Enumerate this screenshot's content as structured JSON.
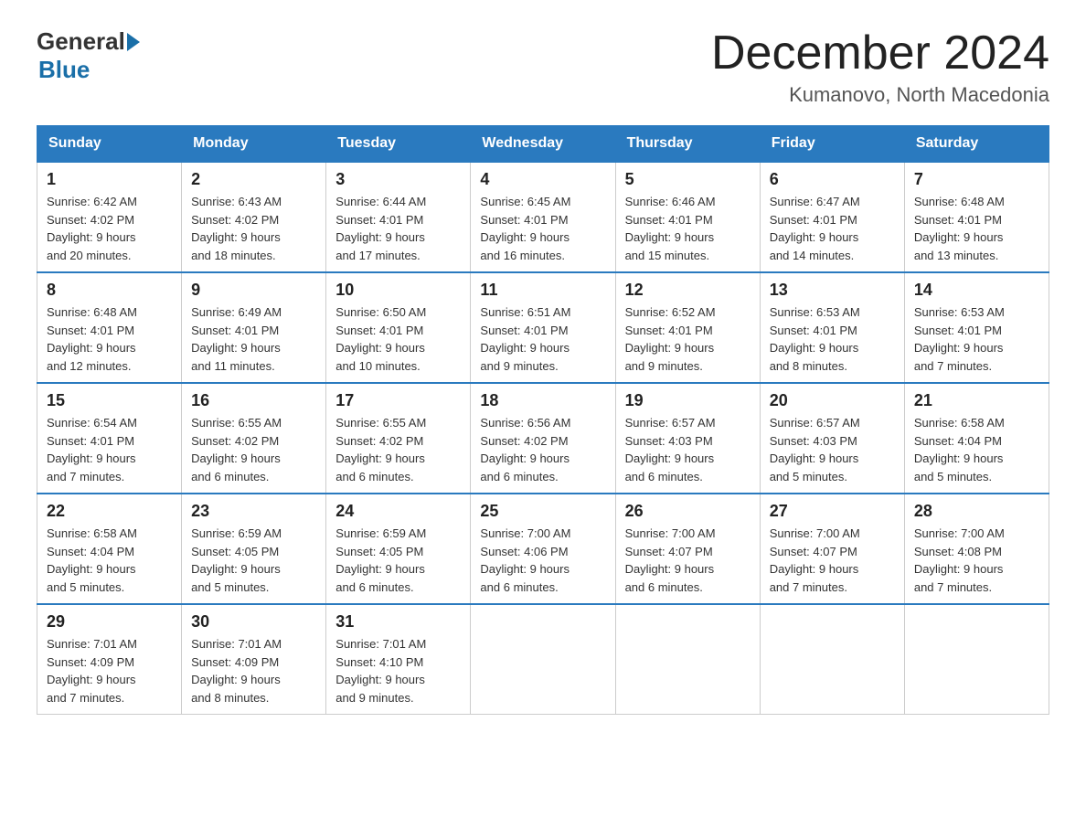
{
  "header": {
    "logo_general": "General",
    "logo_blue": "Blue",
    "title": "December 2024",
    "subtitle": "Kumanovo, North Macedonia"
  },
  "days_of_week": [
    "Sunday",
    "Monday",
    "Tuesday",
    "Wednesday",
    "Thursday",
    "Friday",
    "Saturday"
  ],
  "weeks": [
    [
      {
        "day": "1",
        "sunrise": "6:42 AM",
        "sunset": "4:02 PM",
        "daylight": "9 hours and 20 minutes."
      },
      {
        "day": "2",
        "sunrise": "6:43 AM",
        "sunset": "4:02 PM",
        "daylight": "9 hours and 18 minutes."
      },
      {
        "day": "3",
        "sunrise": "6:44 AM",
        "sunset": "4:01 PM",
        "daylight": "9 hours and 17 minutes."
      },
      {
        "day": "4",
        "sunrise": "6:45 AM",
        "sunset": "4:01 PM",
        "daylight": "9 hours and 16 minutes."
      },
      {
        "day": "5",
        "sunrise": "6:46 AM",
        "sunset": "4:01 PM",
        "daylight": "9 hours and 15 minutes."
      },
      {
        "day": "6",
        "sunrise": "6:47 AM",
        "sunset": "4:01 PM",
        "daylight": "9 hours and 14 minutes."
      },
      {
        "day": "7",
        "sunrise": "6:48 AM",
        "sunset": "4:01 PM",
        "daylight": "9 hours and 13 minutes."
      }
    ],
    [
      {
        "day": "8",
        "sunrise": "6:48 AM",
        "sunset": "4:01 PM",
        "daylight": "9 hours and 12 minutes."
      },
      {
        "day": "9",
        "sunrise": "6:49 AM",
        "sunset": "4:01 PM",
        "daylight": "9 hours and 11 minutes."
      },
      {
        "day": "10",
        "sunrise": "6:50 AM",
        "sunset": "4:01 PM",
        "daylight": "9 hours and 10 minutes."
      },
      {
        "day": "11",
        "sunrise": "6:51 AM",
        "sunset": "4:01 PM",
        "daylight": "9 hours and 9 minutes."
      },
      {
        "day": "12",
        "sunrise": "6:52 AM",
        "sunset": "4:01 PM",
        "daylight": "9 hours and 9 minutes."
      },
      {
        "day": "13",
        "sunrise": "6:53 AM",
        "sunset": "4:01 PM",
        "daylight": "9 hours and 8 minutes."
      },
      {
        "day": "14",
        "sunrise": "6:53 AM",
        "sunset": "4:01 PM",
        "daylight": "9 hours and 7 minutes."
      }
    ],
    [
      {
        "day": "15",
        "sunrise": "6:54 AM",
        "sunset": "4:01 PM",
        "daylight": "9 hours and 7 minutes."
      },
      {
        "day": "16",
        "sunrise": "6:55 AM",
        "sunset": "4:02 PM",
        "daylight": "9 hours and 6 minutes."
      },
      {
        "day": "17",
        "sunrise": "6:55 AM",
        "sunset": "4:02 PM",
        "daylight": "9 hours and 6 minutes."
      },
      {
        "day": "18",
        "sunrise": "6:56 AM",
        "sunset": "4:02 PM",
        "daylight": "9 hours and 6 minutes."
      },
      {
        "day": "19",
        "sunrise": "6:57 AM",
        "sunset": "4:03 PM",
        "daylight": "9 hours and 6 minutes."
      },
      {
        "day": "20",
        "sunrise": "6:57 AM",
        "sunset": "4:03 PM",
        "daylight": "9 hours and 5 minutes."
      },
      {
        "day": "21",
        "sunrise": "6:58 AM",
        "sunset": "4:04 PM",
        "daylight": "9 hours and 5 minutes."
      }
    ],
    [
      {
        "day": "22",
        "sunrise": "6:58 AM",
        "sunset": "4:04 PM",
        "daylight": "9 hours and 5 minutes."
      },
      {
        "day": "23",
        "sunrise": "6:59 AM",
        "sunset": "4:05 PM",
        "daylight": "9 hours and 5 minutes."
      },
      {
        "day": "24",
        "sunrise": "6:59 AM",
        "sunset": "4:05 PM",
        "daylight": "9 hours and 6 minutes."
      },
      {
        "day": "25",
        "sunrise": "7:00 AM",
        "sunset": "4:06 PM",
        "daylight": "9 hours and 6 minutes."
      },
      {
        "day": "26",
        "sunrise": "7:00 AM",
        "sunset": "4:07 PM",
        "daylight": "9 hours and 6 minutes."
      },
      {
        "day": "27",
        "sunrise": "7:00 AM",
        "sunset": "4:07 PM",
        "daylight": "9 hours and 7 minutes."
      },
      {
        "day": "28",
        "sunrise": "7:00 AM",
        "sunset": "4:08 PM",
        "daylight": "9 hours and 7 minutes."
      }
    ],
    [
      {
        "day": "29",
        "sunrise": "7:01 AM",
        "sunset": "4:09 PM",
        "daylight": "9 hours and 7 minutes."
      },
      {
        "day": "30",
        "sunrise": "7:01 AM",
        "sunset": "4:09 PM",
        "daylight": "9 hours and 8 minutes."
      },
      {
        "day": "31",
        "sunrise": "7:01 AM",
        "sunset": "4:10 PM",
        "daylight": "9 hours and 9 minutes."
      },
      null,
      null,
      null,
      null
    ]
  ],
  "labels": {
    "sunrise": "Sunrise:",
    "sunset": "Sunset:",
    "daylight": "Daylight:"
  }
}
